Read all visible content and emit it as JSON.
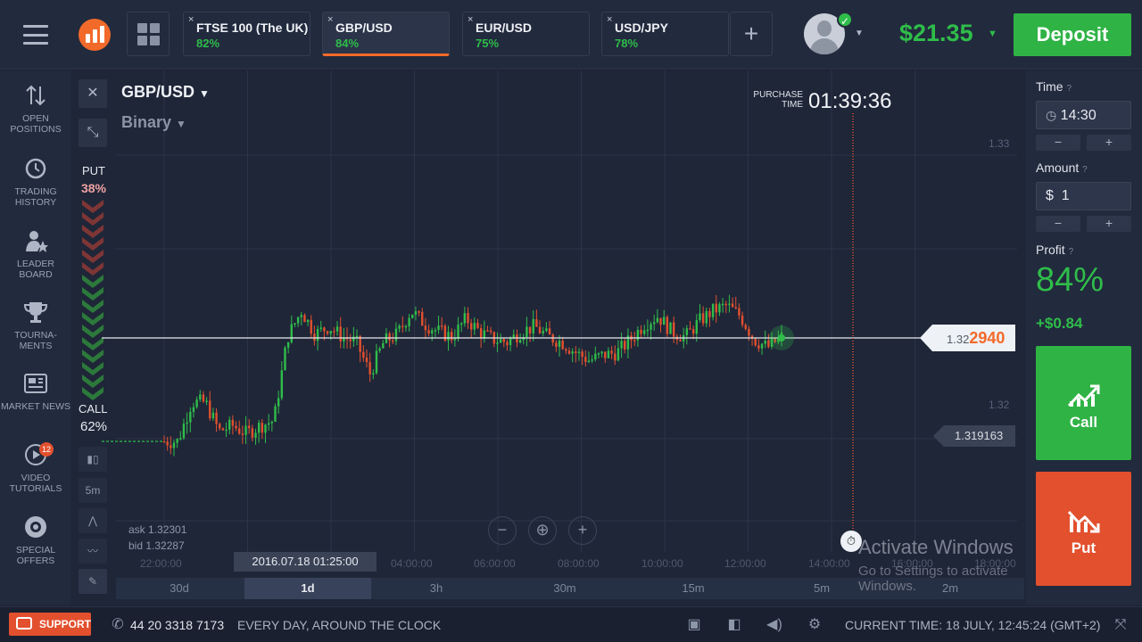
{
  "top_bar": {
    "assets": [
      {
        "name": "FTSE 100 (The UK)",
        "percent": "82%"
      },
      {
        "name": "GBP/USD",
        "percent": "84%"
      },
      {
        "name": "EUR/USD",
        "percent": "75%"
      },
      {
        "name": "USD/JPY",
        "percent": "78%"
      }
    ],
    "close_glyph": "×",
    "add_glyph": "+",
    "balance": "$21.35",
    "deposit_label": "Deposit"
  },
  "sidebar": {
    "items": [
      {
        "label": "OPEN POSITIONS"
      },
      {
        "label": "TRADING HISTORY"
      },
      {
        "label": "LEADER BOARD"
      },
      {
        "label": "TOURNA-MENTS"
      },
      {
        "label": "MARKET NEWS"
      },
      {
        "label": "VIDEO TUTORIALS",
        "badge": "12"
      },
      {
        "label": "SPECIAL OFFERS"
      }
    ]
  },
  "chart": {
    "pair": "GBP/USD",
    "mode": "Binary",
    "put_label": "PUT",
    "put_percent": "38%",
    "call_label": "CALL",
    "call_percent": "62%",
    "purchase_label": "PURCHASE TIME",
    "purchase_time": "01:39:36",
    "current_price_prefix": "1.32",
    "current_price_suffix": "2940",
    "low_price": "1.319163",
    "y_ticks": [
      "1.33",
      "1.32"
    ],
    "ask": "ask 1.32301",
    "bid": "bid  1.32287",
    "x_ticks": [
      "22:00:00",
      "04:00:00",
      "06:00:00",
      "08:00:00",
      "10:00:00",
      "12:00:00",
      "14:00:00",
      "16:00:00",
      "18:00:00"
    ],
    "date_chip": "2016.07.18 01:25:00",
    "periods": [
      "30d",
      "1d",
      "3h",
      "30m",
      "15m",
      "5m",
      "2m"
    ],
    "active_period": "1d",
    "mini_tool_period": "5m",
    "watermark_title": "Activate Windows",
    "watermark_sub": "Go to Settings to activate Windows."
  },
  "chart_data": {
    "type": "candlestick",
    "title": "",
    "series": [
      {
        "name": "GBP/USD",
        "color": "#2fbd4a"
      }
    ],
    "y_ticks": [
      "1.33",
      "1.32"
    ],
    "x_ticks": [
      "22:00:00",
      "04:00:00",
      "06:00:00",
      "08:00:00",
      "10:00:00",
      "12:00:00",
      "14:00:00",
      "16:00:00",
      "18:00:00"
    ],
    "current_price": 1.32294,
    "reference_price": 1.319163,
    "close_path": [
      1.3186,
      1.3186,
      1.3201,
      1.3201,
      1.319,
      1.3192,
      1.3189,
      1.3192,
      1.3194,
      1.3226,
      1.3236,
      1.3227,
      1.323,
      1.3226,
      1.3224,
      1.3212,
      1.3224,
      1.3227,
      1.3236,
      1.3231,
      1.3228,
      1.3226,
      1.3233,
      1.3228,
      1.3225,
      1.3224,
      1.3228,
      1.323,
      1.3226,
      1.3224,
      1.322,
      1.3217,
      1.3219,
      1.322,
      1.3225,
      1.3231,
      1.3234,
      1.3228,
      1.3226,
      1.3232,
      1.3236,
      1.3238,
      1.3234,
      1.3225,
      1.3222,
      1.3226
    ]
  },
  "right_panel": {
    "time_label": "Time",
    "time_value": "14:30",
    "amount_label": "Amount",
    "amount_currency": "$",
    "amount_value": "1",
    "minus_glyph": "−",
    "plus_glyph": "+",
    "info_glyph": "?",
    "profit_label": "Profit",
    "profit_percent": "84%",
    "profit_value": "+$0.84",
    "call_label": "Call",
    "put_label": "Put"
  },
  "bottom_bar": {
    "support_label": "SUPPORT",
    "phone": "44 20 3318 7173",
    "hours": "EVERY DAY, AROUND THE CLOCK",
    "current_time": "CURRENT TIME: 18 JULY, 12:45:24 (GMT+2)"
  }
}
